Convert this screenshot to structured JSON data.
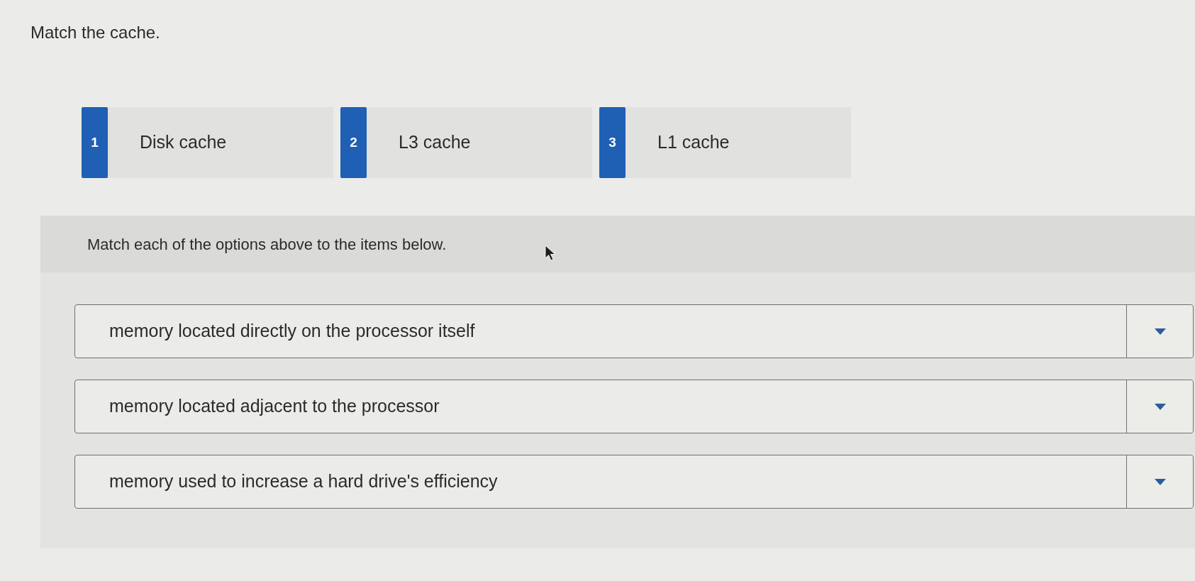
{
  "title": "Match the cache.",
  "options": [
    {
      "number": "1",
      "label": "Disk cache"
    },
    {
      "number": "2",
      "label": "L3 cache"
    },
    {
      "number": "3",
      "label": "L1 cache"
    }
  ],
  "instructions": "Match each of the options above to the items below.",
  "items": [
    {
      "text": "memory located directly on the processor itself"
    },
    {
      "text": "memory located adjacent to the processor"
    },
    {
      "text": "memory used to increase a hard drive's efficiency"
    }
  ]
}
